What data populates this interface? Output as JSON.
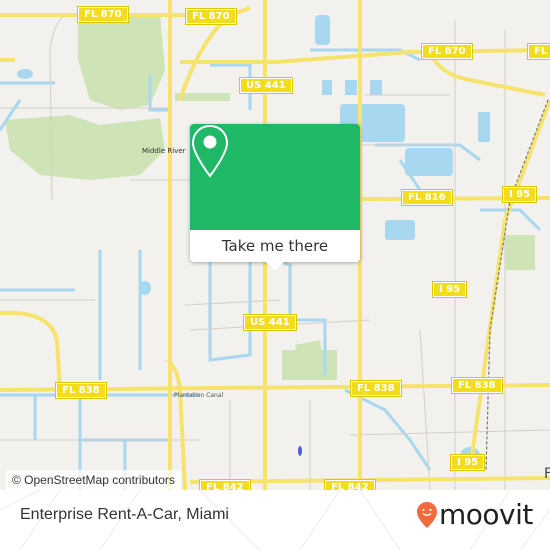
{
  "map": {
    "road_shields": [
      {
        "label": "FL 870",
        "id": "fl870-a"
      },
      {
        "label": "FL 870",
        "id": "fl870-b"
      },
      {
        "label": "FL 870",
        "id": "fl870-c"
      },
      {
        "label": "FL",
        "id": "fl-edge"
      },
      {
        "label": "US 441",
        "id": "us441-a"
      },
      {
        "label": "US 441",
        "id": "us441-b"
      },
      {
        "label": "FL 816",
        "id": "fl816"
      },
      {
        "label": "I 95",
        "id": "i95-a"
      },
      {
        "label": "I 95",
        "id": "i95-b"
      },
      {
        "label": "I 95",
        "id": "i95-c"
      },
      {
        "label": "FL 838",
        "id": "fl838-a"
      },
      {
        "label": "FL 838",
        "id": "fl838-b"
      },
      {
        "label": "FL 838",
        "id": "fl838-c"
      },
      {
        "label": "FL 842",
        "id": "fl842-a"
      },
      {
        "label": "FL 842",
        "id": "fl842-b"
      }
    ],
    "place_labels": {
      "middle_river": "Middle River",
      "plantation_canal": "Plantation Canal",
      "edge_label": "F"
    },
    "attribution": "© OpenStreetMap contributors",
    "colors": {
      "land": "#f2f1ed",
      "water": "#a8d8f0",
      "park": "#cfe4b6",
      "road_major": "#f5e36b",
      "road_minor": "#cfcac4"
    }
  },
  "popup": {
    "icon": "location-pin-icon",
    "cta_label": "Take me there",
    "color": "#1fb866"
  },
  "footer": {
    "place_name": "Enterprise Rent-A-Car, Miami",
    "brand": "moovit",
    "brand_color": "#f26a3d"
  }
}
